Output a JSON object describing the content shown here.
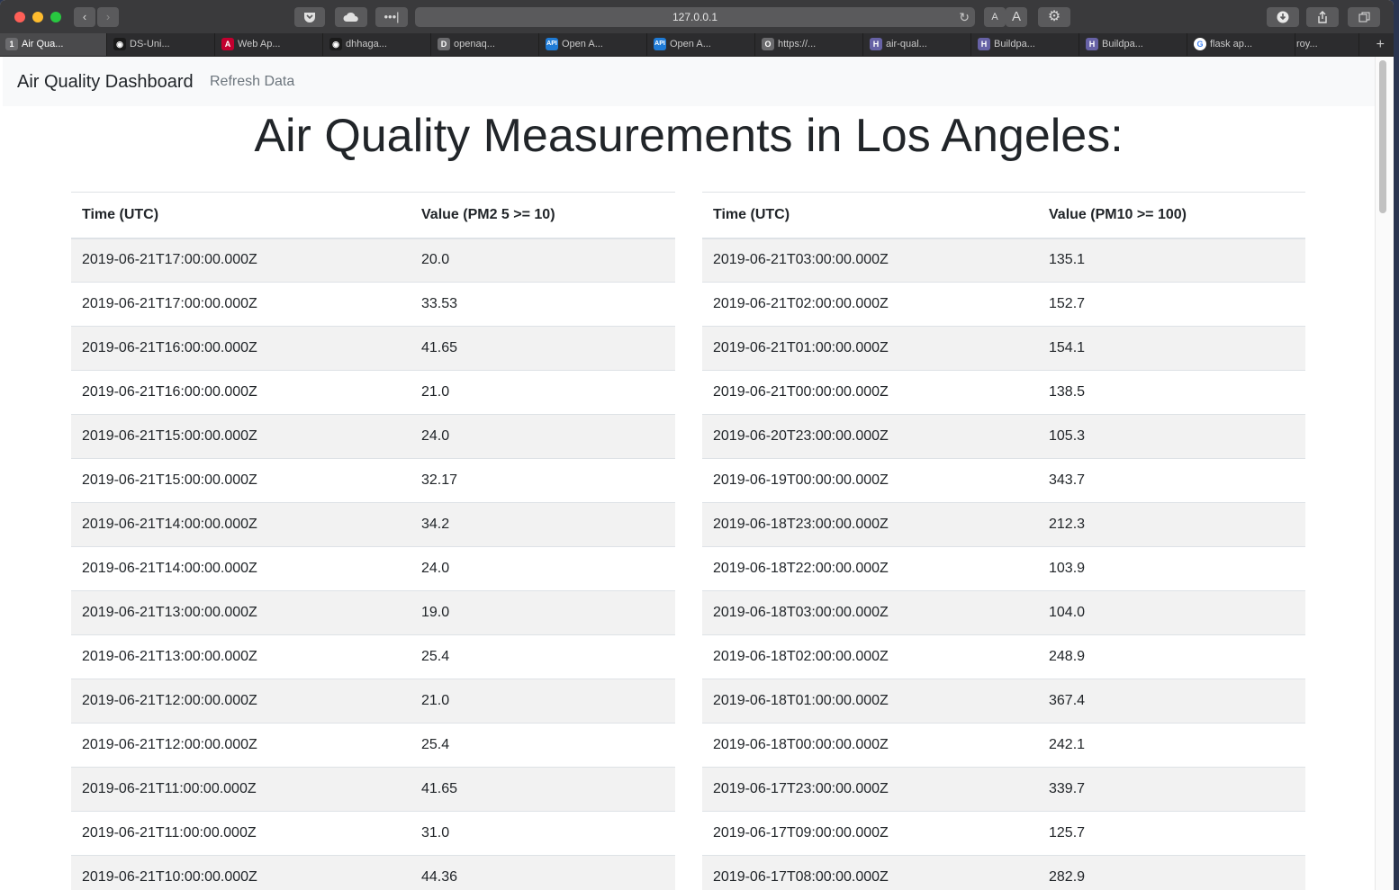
{
  "browser": {
    "url": "127.0.0.1",
    "text_size_small": "A",
    "text_size_large": "A",
    "tabs": [
      {
        "label": "Air Qua...",
        "icon": "number-one-icon",
        "fav_text": "1",
        "color": "#6b6b6e",
        "active": true
      },
      {
        "label": "DS-Uni...",
        "icon": "github-icon",
        "fav_text": "◉",
        "color": "#1a1a1a"
      },
      {
        "label": "Web Ap...",
        "icon": "angular-icon",
        "fav_text": "A",
        "color": "#c3002f"
      },
      {
        "label": "dhhaga...",
        "icon": "github-icon",
        "fav_text": "◉",
        "color": "#1a1a1a"
      },
      {
        "label": "openaq...",
        "icon": "letter-d-icon",
        "fav_text": "D",
        "color": "#6b6b6e"
      },
      {
        "label": "Open A...",
        "icon": "api-icon",
        "fav_text": "API",
        "color": "#1f7bd6"
      },
      {
        "label": "Open A...",
        "icon": "api-icon",
        "fav_text": "API",
        "color": "#1f7bd6"
      },
      {
        "label": "https://...",
        "icon": "letter-o-icon",
        "fav_text": "O",
        "color": "#6b6b6e"
      },
      {
        "label": "air-qual...",
        "icon": "heroku-icon",
        "fav_text": "H",
        "color": "#6762a6"
      },
      {
        "label": "Buildpa...",
        "icon": "heroku-icon",
        "fav_text": "H",
        "color": "#6762a6"
      },
      {
        "label": "Buildpa...",
        "icon": "heroku-icon",
        "fav_text": "H",
        "color": "#6762a6"
      },
      {
        "label": "flask ap...",
        "icon": "google-icon",
        "fav_text": "G",
        "color": "#ffffff"
      },
      {
        "label": "roy...",
        "icon": "none",
        "fav_text": "",
        "color": "#2c2c2e"
      }
    ]
  },
  "navbar": {
    "brand": "Air Quality Dashboard",
    "refresh_link": "Refresh Data"
  },
  "heading": "Air Quality Measurements in Los Angeles:",
  "pm25_table": {
    "headers": [
      "Time (UTC)",
      "Value (PM2 5 >= 10)"
    ],
    "rows": [
      [
        "2019-06-21T17:00:00.000Z",
        "20.0"
      ],
      [
        "2019-06-21T17:00:00.000Z",
        "33.53"
      ],
      [
        "2019-06-21T16:00:00.000Z",
        "41.65"
      ],
      [
        "2019-06-21T16:00:00.000Z",
        "21.0"
      ],
      [
        "2019-06-21T15:00:00.000Z",
        "24.0"
      ],
      [
        "2019-06-21T15:00:00.000Z",
        "32.17"
      ],
      [
        "2019-06-21T14:00:00.000Z",
        "34.2"
      ],
      [
        "2019-06-21T14:00:00.000Z",
        "24.0"
      ],
      [
        "2019-06-21T13:00:00.000Z",
        "19.0"
      ],
      [
        "2019-06-21T13:00:00.000Z",
        "25.4"
      ],
      [
        "2019-06-21T12:00:00.000Z",
        "21.0"
      ],
      [
        "2019-06-21T12:00:00.000Z",
        "25.4"
      ],
      [
        "2019-06-21T11:00:00.000Z",
        "41.65"
      ],
      [
        "2019-06-21T11:00:00.000Z",
        "31.0"
      ],
      [
        "2019-06-21T10:00:00.000Z",
        "44.36"
      ]
    ]
  },
  "pm10_table": {
    "headers": [
      "Time (UTC)",
      "Value (PM10 >= 100)"
    ],
    "rows": [
      [
        "2019-06-21T03:00:00.000Z",
        "135.1"
      ],
      [
        "2019-06-21T02:00:00.000Z",
        "152.7"
      ],
      [
        "2019-06-21T01:00:00.000Z",
        "154.1"
      ],
      [
        "2019-06-21T00:00:00.000Z",
        "138.5"
      ],
      [
        "2019-06-20T23:00:00.000Z",
        "105.3"
      ],
      [
        "2019-06-19T00:00:00.000Z",
        "343.7"
      ],
      [
        "2019-06-18T23:00:00.000Z",
        "212.3"
      ],
      [
        "2019-06-18T22:00:00.000Z",
        "103.9"
      ],
      [
        "2019-06-18T03:00:00.000Z",
        "104.0"
      ],
      [
        "2019-06-18T02:00:00.000Z",
        "248.9"
      ],
      [
        "2019-06-18T01:00:00.000Z",
        "367.4"
      ],
      [
        "2019-06-18T00:00:00.000Z",
        "242.1"
      ],
      [
        "2019-06-17T23:00:00.000Z",
        "339.7"
      ],
      [
        "2019-06-17T09:00:00.000Z",
        "125.7"
      ],
      [
        "2019-06-17T08:00:00.000Z",
        "282.9"
      ]
    ]
  }
}
